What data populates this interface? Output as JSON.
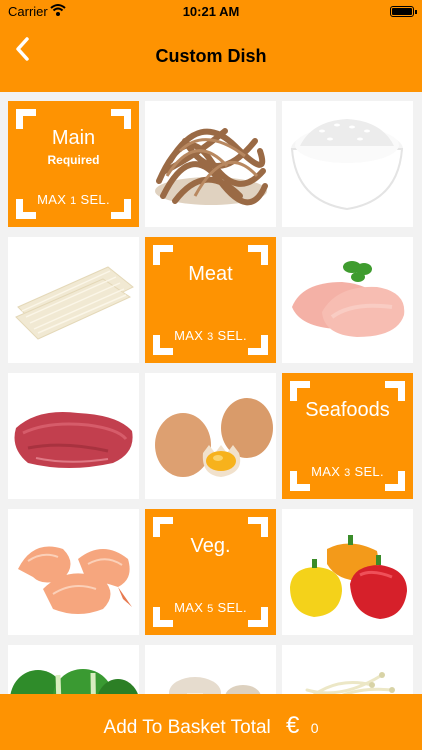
{
  "status_bar": {
    "carrier": "Carrier",
    "time": "10:21 AM"
  },
  "nav": {
    "title": "Custom Dish",
    "back_icon": "chevron-left-icon"
  },
  "categories": {
    "main": {
      "name": "Main",
      "required": "Required",
      "max_prefix": "MAX",
      "max_n": "1",
      "max_suffix": "SEL."
    },
    "meat": {
      "name": "Meat",
      "max_prefix": "MAX",
      "max_n": "3",
      "max_suffix": "SEL."
    },
    "seafoods": {
      "name": "Seafoods",
      "max_prefix": "MAX",
      "max_n": "3",
      "max_suffix": "SEL."
    },
    "veg": {
      "name": "Veg.",
      "max_prefix": "MAX",
      "max_n": "5",
      "max_suffix": "SEL."
    }
  },
  "items": [
    "udon-noodles-image",
    "rice-image",
    "rice-noodles-image",
    "chicken-breast-image",
    "beef-image",
    "eggs-image",
    "shrimp-image",
    "bell-peppers-image",
    "bok-choy-image",
    "mushrooms-image",
    "bean-sprouts-image"
  ],
  "footer": {
    "label": "Add To Basket Total",
    "currency": "€",
    "amount": "0"
  },
  "colors": {
    "accent": "#fe9302",
    "background": "#f2f2f2"
  }
}
